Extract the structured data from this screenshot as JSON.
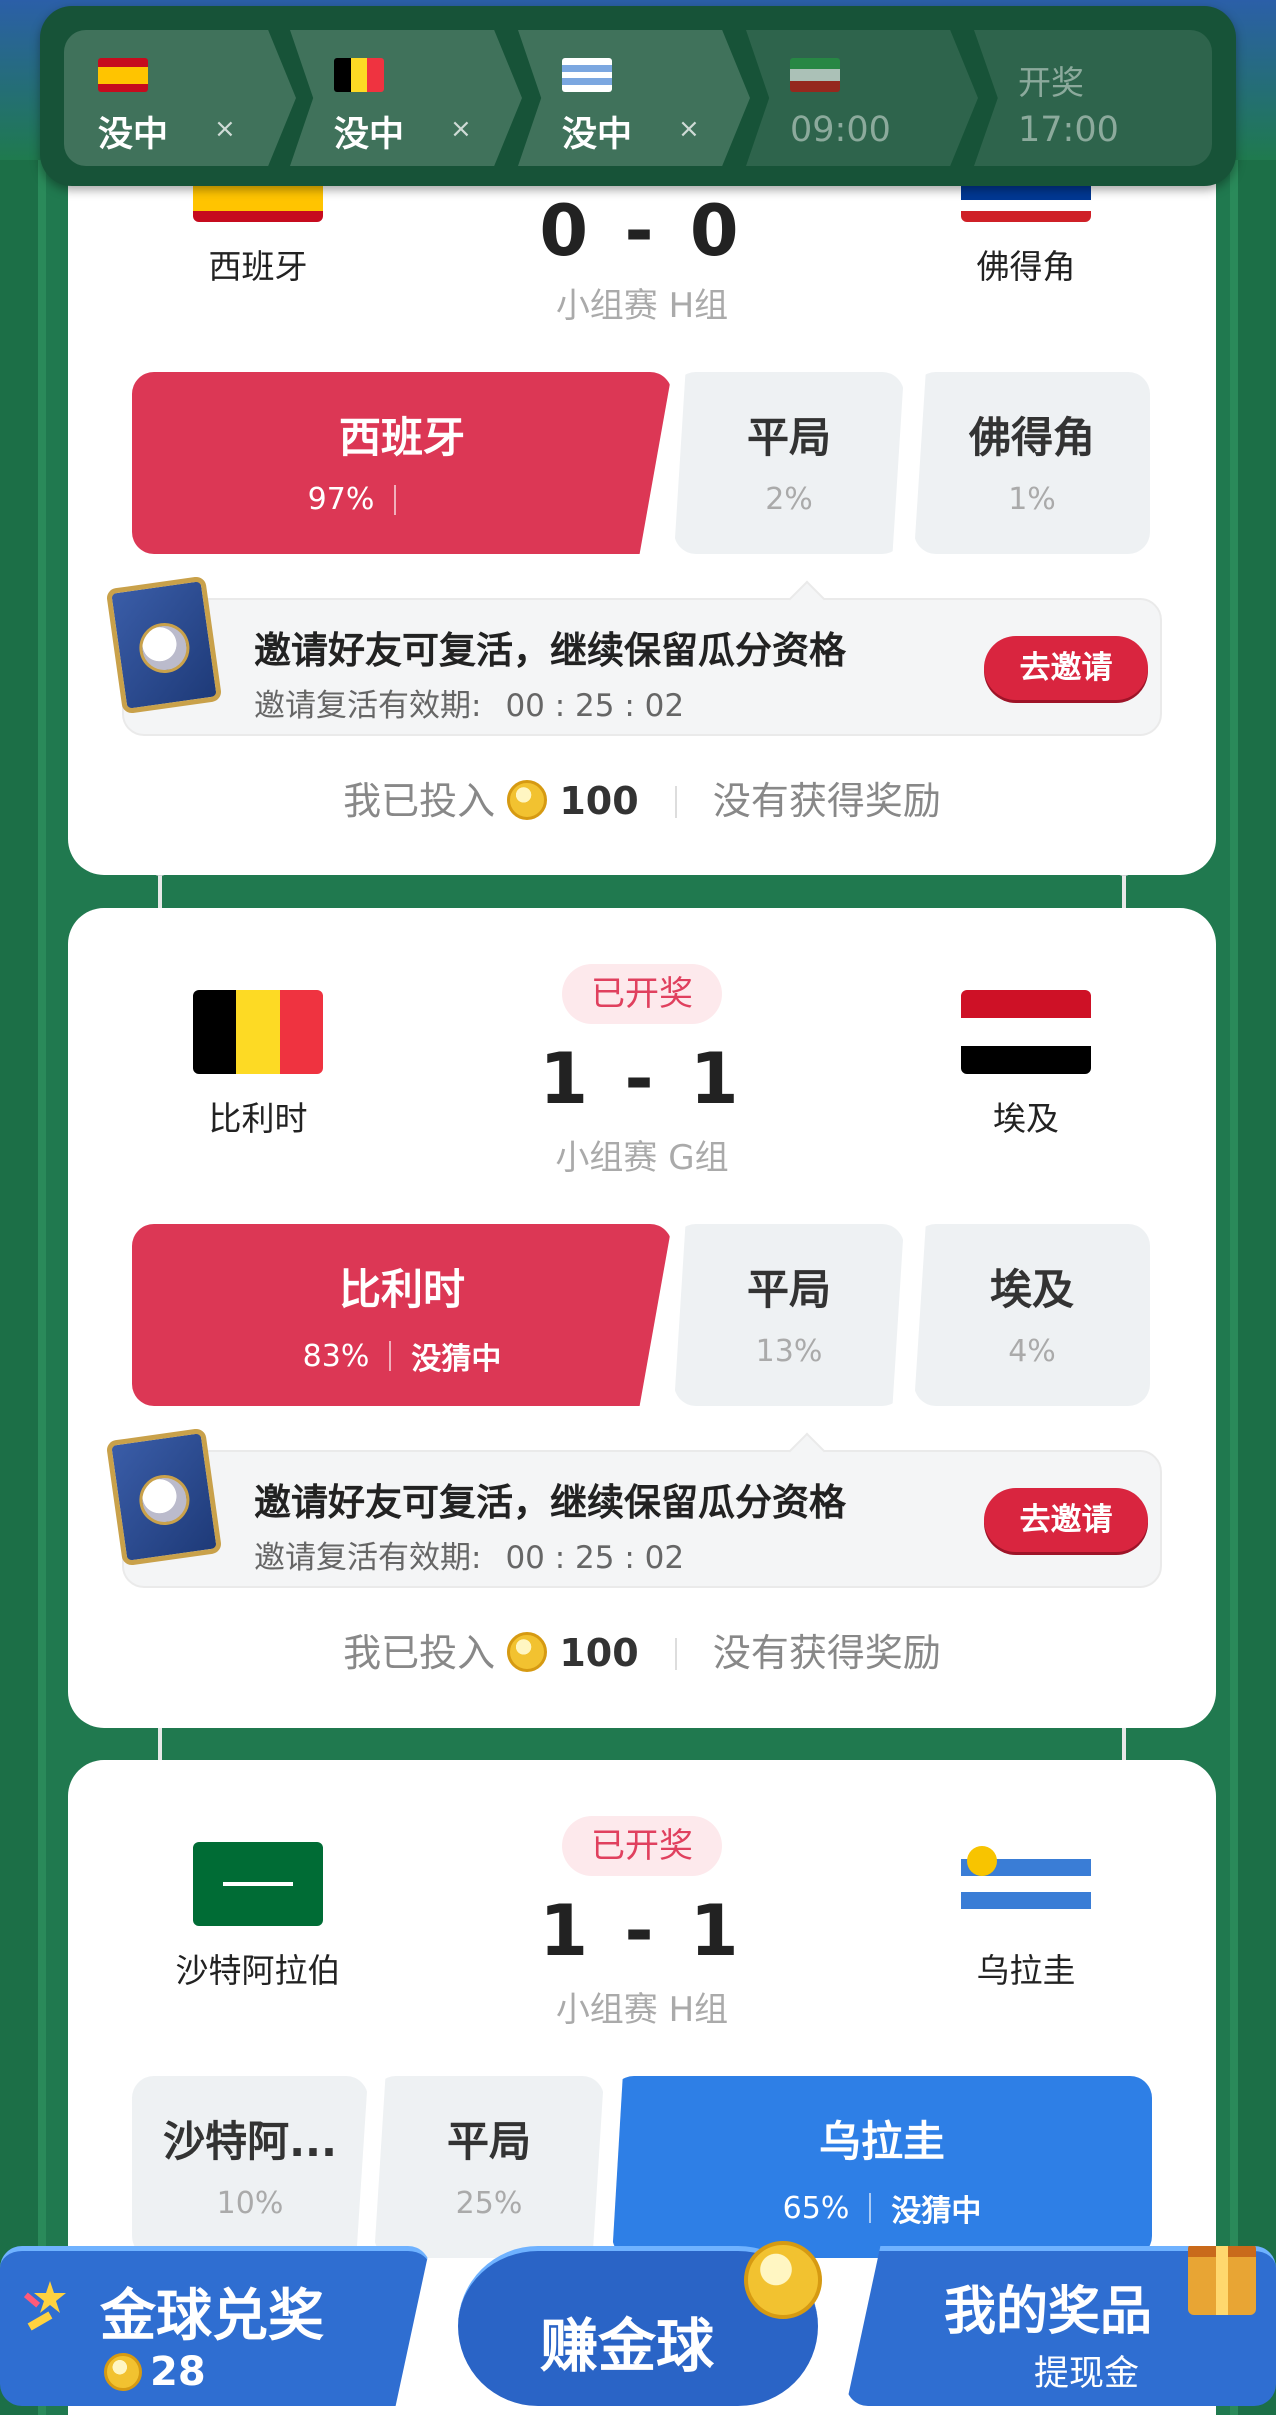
{
  "topbar": {
    "items": [
      {
        "label": "没中",
        "close": "×",
        "flag": "spain-flag-icon"
      },
      {
        "label": "没中",
        "close": "×",
        "flag": "belgium-flag-icon"
      },
      {
        "label": "没中",
        "close": "×",
        "flag": "uruguay-flag-icon"
      },
      {
        "time": "09:00",
        "flag": "iran-flag-icon"
      },
      {
        "top": "开奖",
        "time": "17:00"
      }
    ]
  },
  "matches": [
    {
      "home": "西班牙",
      "away": "佛得角",
      "score": "0 - 0",
      "group": "小组赛 H组",
      "options": [
        {
          "name": "西班牙",
          "pct": "97%"
        },
        {
          "name": "平局",
          "pct": "2%"
        },
        {
          "name": "佛得角",
          "pct": "1%"
        }
      ],
      "invite": {
        "title": "邀请好友可复活，继续保留瓜分资格",
        "sub": "邀请复活有效期:",
        "timer": "00 : 25 : 02",
        "button": "去邀请"
      },
      "stake": {
        "label": "我已投入",
        "amount": "100",
        "result": "没有获得奖励"
      }
    },
    {
      "home": "比利时",
      "away": "埃及",
      "score": "1 - 1",
      "group": "小组赛 G组",
      "badge": "已开奖",
      "options": [
        {
          "name": "比利时",
          "pct": "83%",
          "status": "没猜中"
        },
        {
          "name": "平局",
          "pct": "13%"
        },
        {
          "name": "埃及",
          "pct": "4%"
        }
      ],
      "invite": {
        "title": "邀请好友可复活，继续保留瓜分资格",
        "sub": "邀请复活有效期:",
        "timer": "00 : 25 : 02",
        "button": "去邀请"
      },
      "stake": {
        "label": "我已投入",
        "amount": "100",
        "result": "没有获得奖励"
      }
    },
    {
      "home": "沙特阿拉伯",
      "away": "乌拉圭",
      "score": "1 - 1",
      "group": "小组赛 H组",
      "badge": "已开奖",
      "options": [
        {
          "name": "沙特阿...",
          "pct": "10%"
        },
        {
          "name": "平局",
          "pct": "25%"
        },
        {
          "name": "乌拉圭",
          "pct": "65%",
          "status": "没猜中"
        }
      ]
    }
  ],
  "bottomnav": {
    "left": {
      "title": "金球兑奖",
      "count": "28"
    },
    "mid": {
      "title": "赚金球"
    },
    "right": {
      "title": "我的奖品",
      "sub": "提现金"
    }
  },
  "colors": {
    "accent_red": "#dc3755",
    "accent_blue": "#2e7fe6",
    "field_green": "#1f7a4e"
  }
}
